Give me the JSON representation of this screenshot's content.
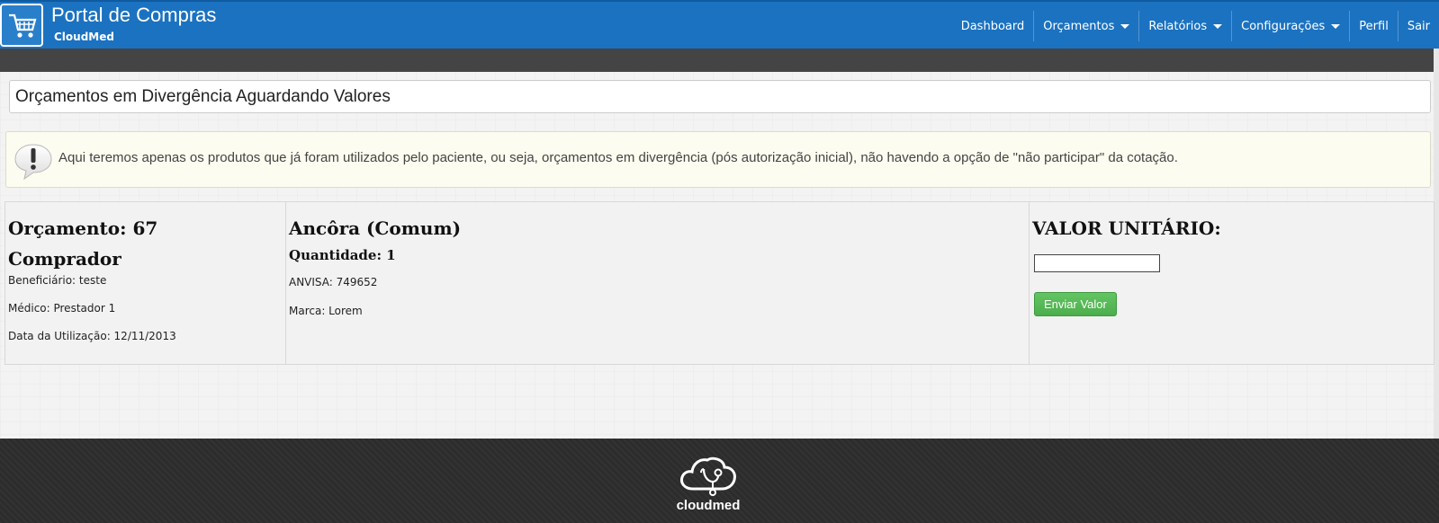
{
  "header": {
    "brand_title": "Portal de Compras",
    "brand_sub": "CloudMed",
    "nav": [
      {
        "label": "Dashboard",
        "dropdown": false
      },
      {
        "label": "Orçamentos",
        "dropdown": true
      },
      {
        "label": "Relatórios",
        "dropdown": true
      },
      {
        "label": "Configurações",
        "dropdown": true
      },
      {
        "label": "Perfil",
        "dropdown": false
      },
      {
        "label": "Sair",
        "dropdown": false
      }
    ],
    "colors": {
      "primary": "#1b72c0",
      "subbar": "#444444"
    }
  },
  "page": {
    "title": "Orçamentos em Divergência Aguardando Valores",
    "info_text": "Aqui teremos apenas os produtos que já foram utilizados pelo paciente, ou seja, orçamentos em divergência (pós autorização inicial), não havendo a opção de \"não participar\" da cotação."
  },
  "quote": {
    "budget": "Orçamento: 67",
    "buyer": "Comprador",
    "beneficiary": "Beneficiário: teste",
    "doctor": "Médico: Prestador 1",
    "usage_date": "Data da Utilização: 12/11/2013",
    "product": "Ancôra (Comum)",
    "quantity": "Quantidade: 1",
    "anvisa": "ANVISA: 749652",
    "brand": "Marca: Lorem",
    "unit_value_label": "VALOR UNITÁRIO:",
    "unit_value_input": "",
    "send_button": "Enviar Valor"
  },
  "footer": {
    "logo_text": "cloudmed"
  },
  "icons": {
    "brand": "shopping-cart-icon",
    "info": "exclamation-bubble-icon",
    "footer": "cloud-stethoscope-icon"
  }
}
